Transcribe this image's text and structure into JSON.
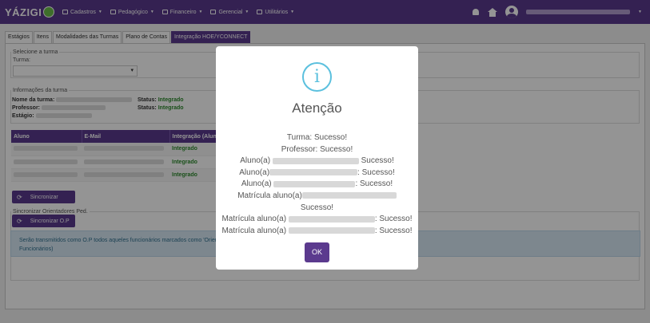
{
  "header": {
    "logo": "YÁZIGI",
    "nav": [
      {
        "label": "Cadastros",
        "icon": "table-icon"
      },
      {
        "label": "Pedagógico",
        "icon": "graduation-icon"
      },
      {
        "label": "Financeiro",
        "icon": "money-icon"
      },
      {
        "label": "Gerencial",
        "icon": "gauge-icon"
      },
      {
        "label": "Utilitários",
        "icon": "cogs-icon"
      }
    ]
  },
  "tabs": [
    "Estágios",
    "Itens",
    "Modalidades das Turmas",
    "Plano de Contas",
    "Integração HOE/YCONNECT"
  ],
  "select_section": {
    "legend": "Selecione a turma",
    "label": "Turma:"
  },
  "info_section": {
    "legend": "Informações da turma",
    "turma_label": "Nome da turma:",
    "professor_label": "Professor:",
    "estagio_label": "Estágio:",
    "status_label": "Status:",
    "status1": "Integrado",
    "status2": "Integrado"
  },
  "table": {
    "headers": [
      "Aluno",
      "E-Mail",
      "Integração (Aluno)"
    ],
    "rows": [
      {
        "status": "Integrado"
      },
      {
        "status": "Integrado"
      },
      {
        "status": "Integrado"
      }
    ]
  },
  "buttons": {
    "sync": "Sincronizar",
    "sync_op": "Sincronizar O.P"
  },
  "op_section": {
    "legend": "Sincronizar Orientadores Ped."
  },
  "alert": {
    "line1": "Serão transmitidos como O.P todos aqueles funcionários marcados como 'Orien",
    "line2": "Funcionários)"
  },
  "modal": {
    "title": "Atenção",
    "line_turma": "Turma: Sucesso!",
    "line_prof": "Professor: Sucesso!",
    "aluno_prefix": "Aluno(a)",
    "sucesso": "Sucesso!",
    "sucesso_colon": ": Sucesso!",
    "matricula_prefix": "Matrícula aluno(a)",
    "ok": "OK"
  },
  "colors": {
    "primary": "#5b3a8e",
    "info": "#5bc0de",
    "success": "#2e8b2e"
  }
}
